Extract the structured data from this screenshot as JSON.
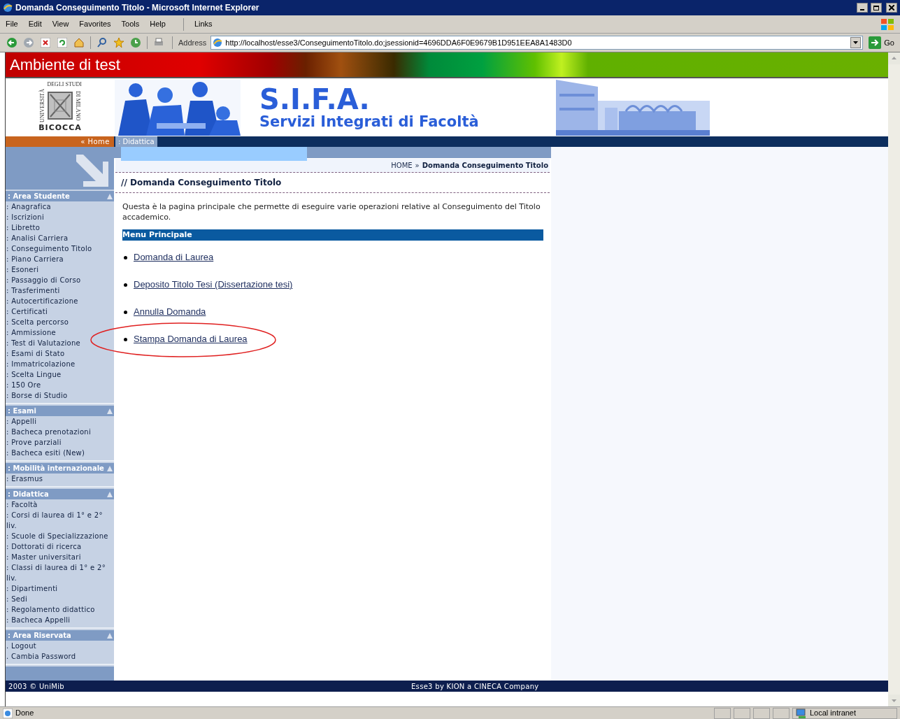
{
  "window": {
    "title": "Domanda Conseguimento Titolo - Microsoft Internet Explorer"
  },
  "menu_bar": [
    "File",
    "Edit",
    "View",
    "Favorites",
    "Tools",
    "Help"
  ],
  "links_label": "Links",
  "address_bar": {
    "label": "Address",
    "url": "http://localhost/esse3/ConseguimentoTitolo.do;jsessionid=4696DDA6F0E9679B1D951EEA8A1483D0",
    "go": "Go"
  },
  "banner": {
    "title": "Ambiente di test"
  },
  "header": {
    "logo": {
      "top": "DEGLI STUDI",
      "left": "UNIVERSITÀ",
      "right": "DI MILANO",
      "bottom": "BICOCCA"
    },
    "acronym": "S.I.F.A.",
    "subtitle": "Servizi Integrati di Facoltà"
  },
  "nav": {
    "home": "« Home",
    "tab": ": Didattica"
  },
  "sidebar": {
    "sections": [
      {
        "title": ": Area Studente",
        "items": [
          ": Anagrafica",
          ": Iscrizioni",
          ": Libretto",
          ": Analisi Carriera",
          ": Conseguimento Titolo",
          ": Piano Carriera",
          ": Esoneri",
          ": Passaggio di Corso",
          ": Trasferimenti",
          ": Autocertificazione",
          ": Certificati",
          ": Scelta percorso",
          ": Ammissione",
          ": Test di Valutazione",
          ": Esami di Stato",
          ": Immatricolazione",
          ": Scelta Lingue",
          ": 150 Ore",
          ": Borse di Studio"
        ]
      },
      {
        "title": ": Esami",
        "items": [
          ": Appelli",
          ": Bacheca prenotazioni",
          ": Prove parziali",
          ": Bacheca esiti (New)"
        ]
      },
      {
        "title": ": Mobilità internazionale",
        "items": [
          ": Erasmus"
        ]
      },
      {
        "title": ": Didattica",
        "items": [
          ": Facoltà",
          ": Corsi di laurea di 1° e 2° liv.",
          ": Scuole di Specializzazione",
          ": Dottorati di ricerca",
          ": Master universitari",
          ": Classi di laurea di 1° e 2° liv.",
          ": Dipartimenti",
          ": Sedi",
          ": Regolamento didattico",
          ": Bacheca Appelli"
        ]
      },
      {
        "title": ": Area Riservata",
        "items": [
          ". Logout",
          ". Cambia Password"
        ]
      }
    ]
  },
  "breadcrumb": {
    "home": "HOME",
    "separator": "»",
    "current": "Domanda Conseguimento Titolo"
  },
  "page_title": "// Domanda Conseguimento Titolo",
  "intro": "Questa è la pagina principale che permette di eseguire varie operazioni relative al Conseguimento del Titolo accademico.",
  "menu": {
    "title": "Menu Principale",
    "links": [
      {
        "label": "Domanda di Laurea",
        "circled": false
      },
      {
        "label": "Deposito Titolo Tesi (Dissertazione tesi)",
        "circled": false
      },
      {
        "label": "Annulla Domanda",
        "circled": false
      },
      {
        "label": "Stampa Domanda di Laurea",
        "circled": true
      }
    ]
  },
  "footer": {
    "left": "2003 © UniMib",
    "center": "Esse3 by KION a CINECA Company"
  },
  "status_bar": {
    "text": "Done",
    "zone": "Local intranet"
  }
}
